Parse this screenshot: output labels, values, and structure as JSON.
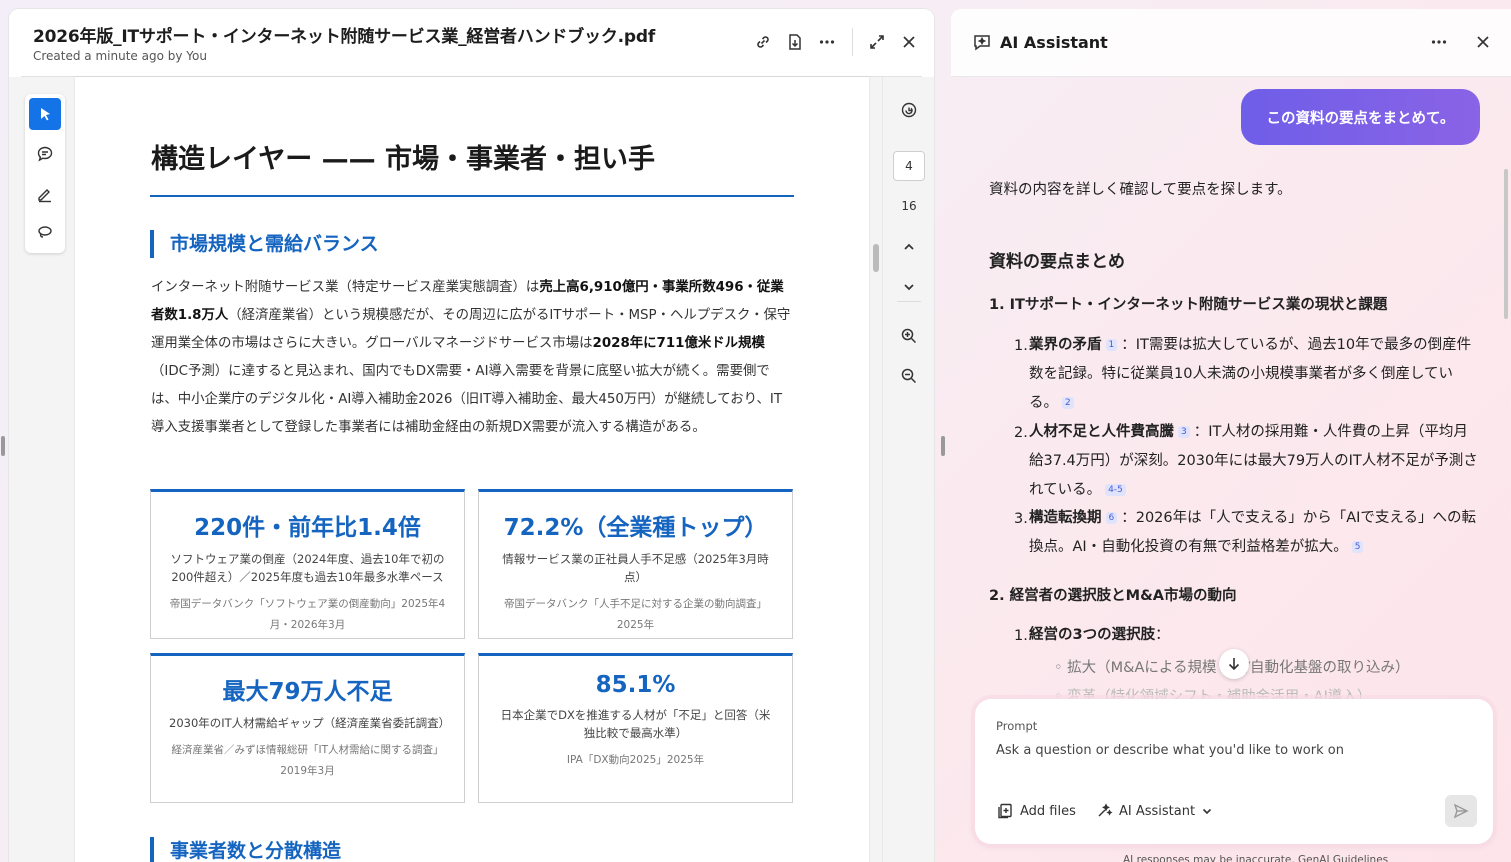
{
  "document": {
    "title": "2026年版_ITサポート・インターネット附随サービス業_経営者ハンドブック.pdf",
    "subtitle": "Created a minute ago by You",
    "current_page": "4",
    "total_pages": "16",
    "page": {
      "heading": "構造レイヤー —— 市場・事業者・担い手",
      "section1": "市場規模と需給バランス",
      "paragraph": {
        "p1": "インターネット附随サービス業（特定サービス産業実態調査）は",
        "b1": "売上高6,910億円・事業所数496・従業者数1.8万人",
        "p2": "（経済産業省）という規模感だが、その周辺に広がるITサポート・MSP・ヘルプデスク・保守運用業全体の市場はさらに大きい。グローバルマネージドサービス市場は",
        "b2": "2028年に711億米ドル規模",
        "p3": "（IDC予測）に達すると見込まれ、国内でもDX需要・AI導入需要を背景に底堅い拡大が続く。需要側では、中小企業庁のデジタル化・AI導入補助金2026（旧IT導入補助金、最大450万円）が継続しており、IT導入支援事業者として登録した事業者には補助金経由の新規DX需要が流入する構造がある。"
      },
      "cards": [
        {
          "value": "220件・前年比1.4倍",
          "desc": "ソフトウェア業の倒産（2024年度、過去10年で初の200件超え）／2025年度も過去10年最多水準ペース",
          "source": "帝国データバンク「ソフトウェア業の倒産動向」2025年4月・2026年3月"
        },
        {
          "value": "72.2%（全業種トップ）",
          "desc": "情報サービス業の正社員人手不足感（2025年3月時点）",
          "source": "帝国データバンク「人手不足に対する企業の動向調査」2025年"
        },
        {
          "value": "最大79万人不足",
          "desc": "2030年のIT人材需給ギャップ（経済産業省委託調査）",
          "source": "経済産業省／みずほ情報総研「IT人材需給に関する調査」2019年3月"
        },
        {
          "value": "85.1%",
          "desc": "日本企業でDXを推進する人材が「不足」と回答（米独比較で最高水準）",
          "source": "IPA「DX動向2025」2025年"
        }
      ],
      "section2": "事業者数と分散構造"
    }
  },
  "assistant": {
    "title": "AI Assistant",
    "user_message": "この資料の要点をまとめて。",
    "status": "資料の内容を詳しく確認して要点を探します。",
    "summary_heading": "資料の要点まとめ",
    "s1_heading": "1. ITサポート・インターネット附随サービス業の現状と課題",
    "s1_items": [
      {
        "num": "1.",
        "title": "業界の矛盾",
        "cite": "1",
        "text": "：IT需要は拡大しているが、過去10年で最多の倒産件数を記録。特に従業員10人未満の小規模事業者が多く倒産している。",
        "cite2": "2"
      },
      {
        "num": "2.",
        "title": "人材不足と人件費高騰",
        "cite": "3",
        "text": "：IT人材の採用難・人件費の上昇（平均月給37.4万円）が深刻。2030年には最大79万人のIT人材不足が予測されている。",
        "cite2": "4-5"
      },
      {
        "num": "3.",
        "title": "構造転換期",
        "cite": "6",
        "text": "：2026年は「人で支える」から「AIで支える」への転換点。AI・自動化投資の有無で利益格差が拡大。",
        "cite2": "5"
      }
    ],
    "s2_heading": "2. 経営者の選択肢とM&A市場の動向",
    "s2_item_num": "1.",
    "s2_item_title": "経営の3つの選択肢",
    "s2_item_colon": "：",
    "s2_bullet1": "拡大（M&Aによる規模・AI/自動化基盤の取り込み）",
    "s2_bullet2": "変革（特化領域シフト・補助金活用・AI導入）",
    "prompt_label": "Prompt",
    "prompt_placeholder": "Ask a question or describe what you'd like to work on",
    "add_files": "Add files",
    "mode": "AI Assistant",
    "footnote": "AI responses may be inaccurate. GenAI Guidelines"
  }
}
